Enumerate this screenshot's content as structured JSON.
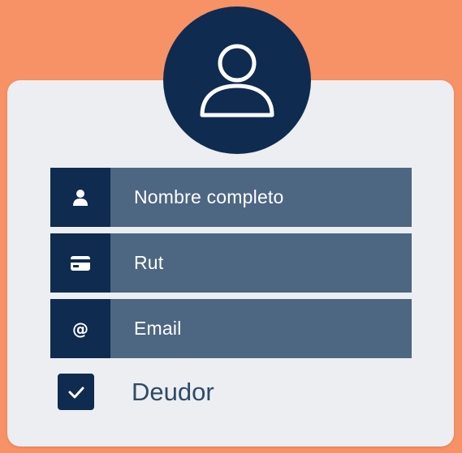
{
  "form": {
    "fields": [
      {
        "icon": "user-icon",
        "placeholder": "Nombre completo"
      },
      {
        "icon": "id-card-icon",
        "placeholder": "Rut"
      },
      {
        "icon": "at-sign-icon",
        "glyph": "@",
        "placeholder": "Email"
      }
    ],
    "checkbox": {
      "label": "Deudor",
      "checked": true,
      "icon": "checkmark-icon"
    }
  },
  "avatar": {
    "icon": "user-avatar-icon"
  },
  "colors": {
    "background": "#f79166",
    "card": "#eceef1",
    "navy": "#0f2b4f",
    "field": "#4d6682",
    "label_text": "#2e4a67"
  }
}
